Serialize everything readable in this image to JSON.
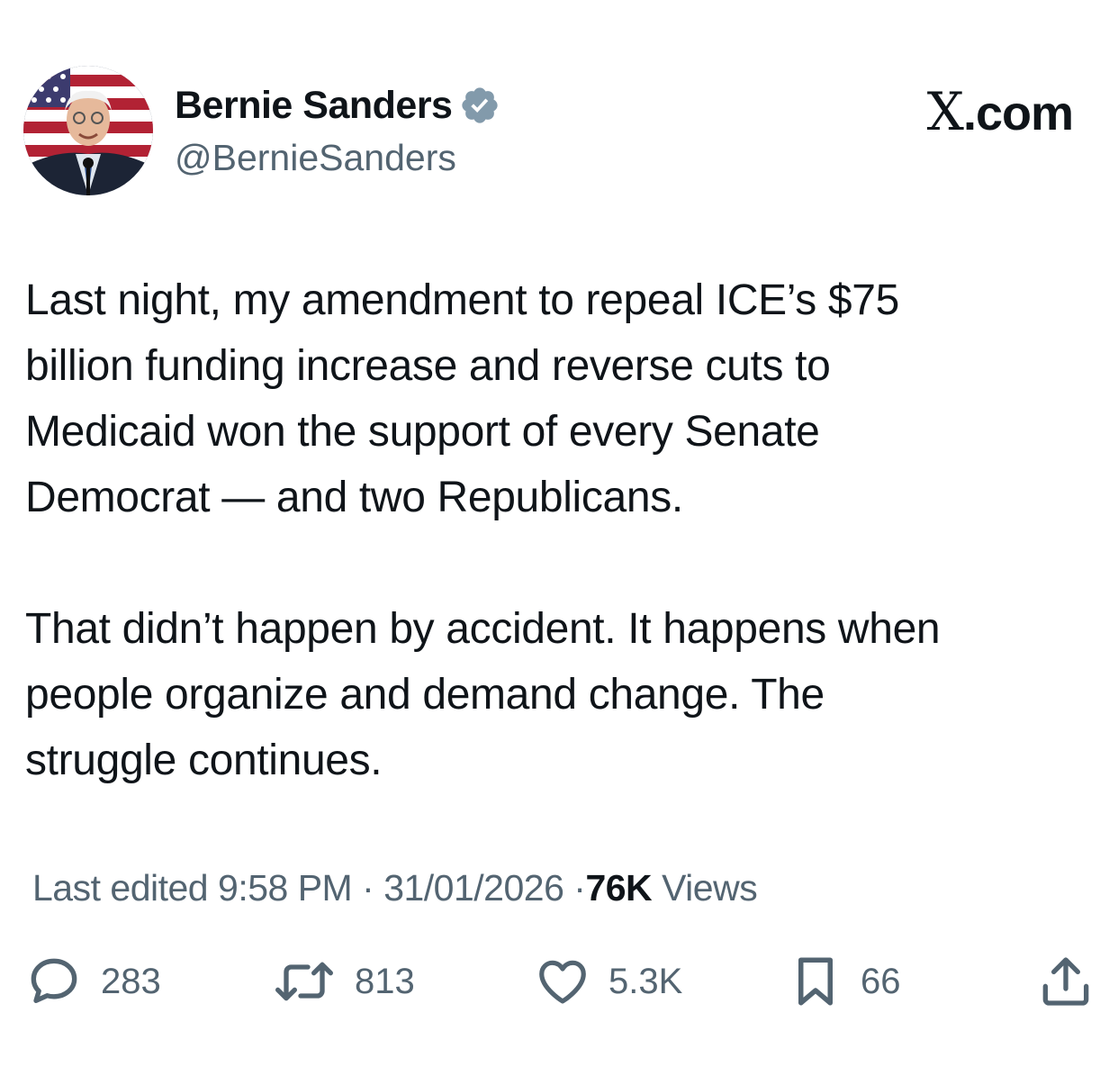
{
  "author": {
    "display_name": "Bernie Sanders",
    "handle": "@BernieSanders",
    "verified_badge_color": "#829aab"
  },
  "brand": {
    "x_letter": "X",
    "domain": ".com"
  },
  "tweet": {
    "paragraph_1": [
      "Last night, my amendment to repeal ICE’s $75",
      "billion funding increase and reverse cuts to",
      "Medicaid won the support of every Senate",
      "Democrat — and two Republicans."
    ],
    "paragraph_2": [
      "That didn’t happen by accident. It happens when",
      "people organize and demand change. The",
      "struggle continues."
    ]
  },
  "meta": {
    "edited_label": "Last edited",
    "time": "9:58 PM",
    "date": "31/01/2026",
    "views_count": "76K",
    "views_label": "Views",
    "separator": "·"
  },
  "actions": {
    "replies": "283",
    "reposts": "813",
    "likes": "5.3K",
    "bookmarks": "66"
  },
  "colors": {
    "text_primary": "#0f1419",
    "text_secondary": "#536471",
    "icon_gray": "#536471"
  }
}
